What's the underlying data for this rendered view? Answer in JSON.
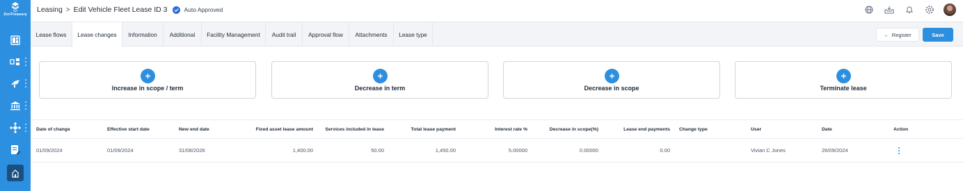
{
  "brand": {
    "name": "ZenTreasury",
    "color": "#2d8fe0"
  },
  "sidebar": {
    "items": [
      {
        "icon": "dashboard-icon"
      },
      {
        "icon": "transactions-icon"
      },
      {
        "icon": "analytics-icon"
      },
      {
        "icon": "bank-icon"
      },
      {
        "icon": "network-icon"
      },
      {
        "icon": "report-edit-icon"
      },
      {
        "icon": "leasing-icon",
        "active": true
      }
    ]
  },
  "header": {
    "breadcrumb_root": "Leasing",
    "breadcrumb_separator": ">",
    "breadcrumb_current": "Edit Vehicle Fleet Lease ID 3",
    "status": "Auto Approved",
    "icons": [
      "globe-icon",
      "inbox-icon",
      "bell-icon",
      "gear-icon",
      "avatar"
    ]
  },
  "tabs": [
    {
      "label": "Lease flows"
    },
    {
      "label": "Lease changes",
      "active": true
    },
    {
      "label": "Information"
    },
    {
      "label": "Additional"
    },
    {
      "label": "Facility Management"
    },
    {
      "label": "Audit trail"
    },
    {
      "label": "Approval flow"
    },
    {
      "label": "Attachments"
    },
    {
      "label": "Lease type"
    }
  ],
  "actions": {
    "register": "Register",
    "register_icon": "←",
    "save": "Save"
  },
  "cards": [
    {
      "label": "Increase in scope / term"
    },
    {
      "label": "Decrease in term"
    },
    {
      "label": "Decrease in scope"
    },
    {
      "label": "Terminate lease"
    }
  ],
  "table": {
    "columns": [
      "Date of change",
      "Effective start date",
      "New end date",
      "Fixed asset lease amount",
      "Services included in lease",
      "Total lease payment",
      "Interest rate %",
      "Decrease in scope(%)",
      "Lease end payments",
      "Change type",
      "User",
      "Date",
      "Action"
    ],
    "rows": [
      {
        "date_of_change": "01/09/2024",
        "effective_start_date": "01/09/2024",
        "new_end_date": "31/08/2026",
        "fixed_asset_lease_amount": "1,400.00",
        "services_included": "50.00",
        "total_lease_payment": "1,450.00",
        "interest_rate": "5.00000",
        "decrease_in_scope": "0.00000",
        "lease_end_payments": "0.00",
        "change_type": "",
        "user": "Vivian C Jones",
        "date": "26/09/2024"
      }
    ]
  }
}
